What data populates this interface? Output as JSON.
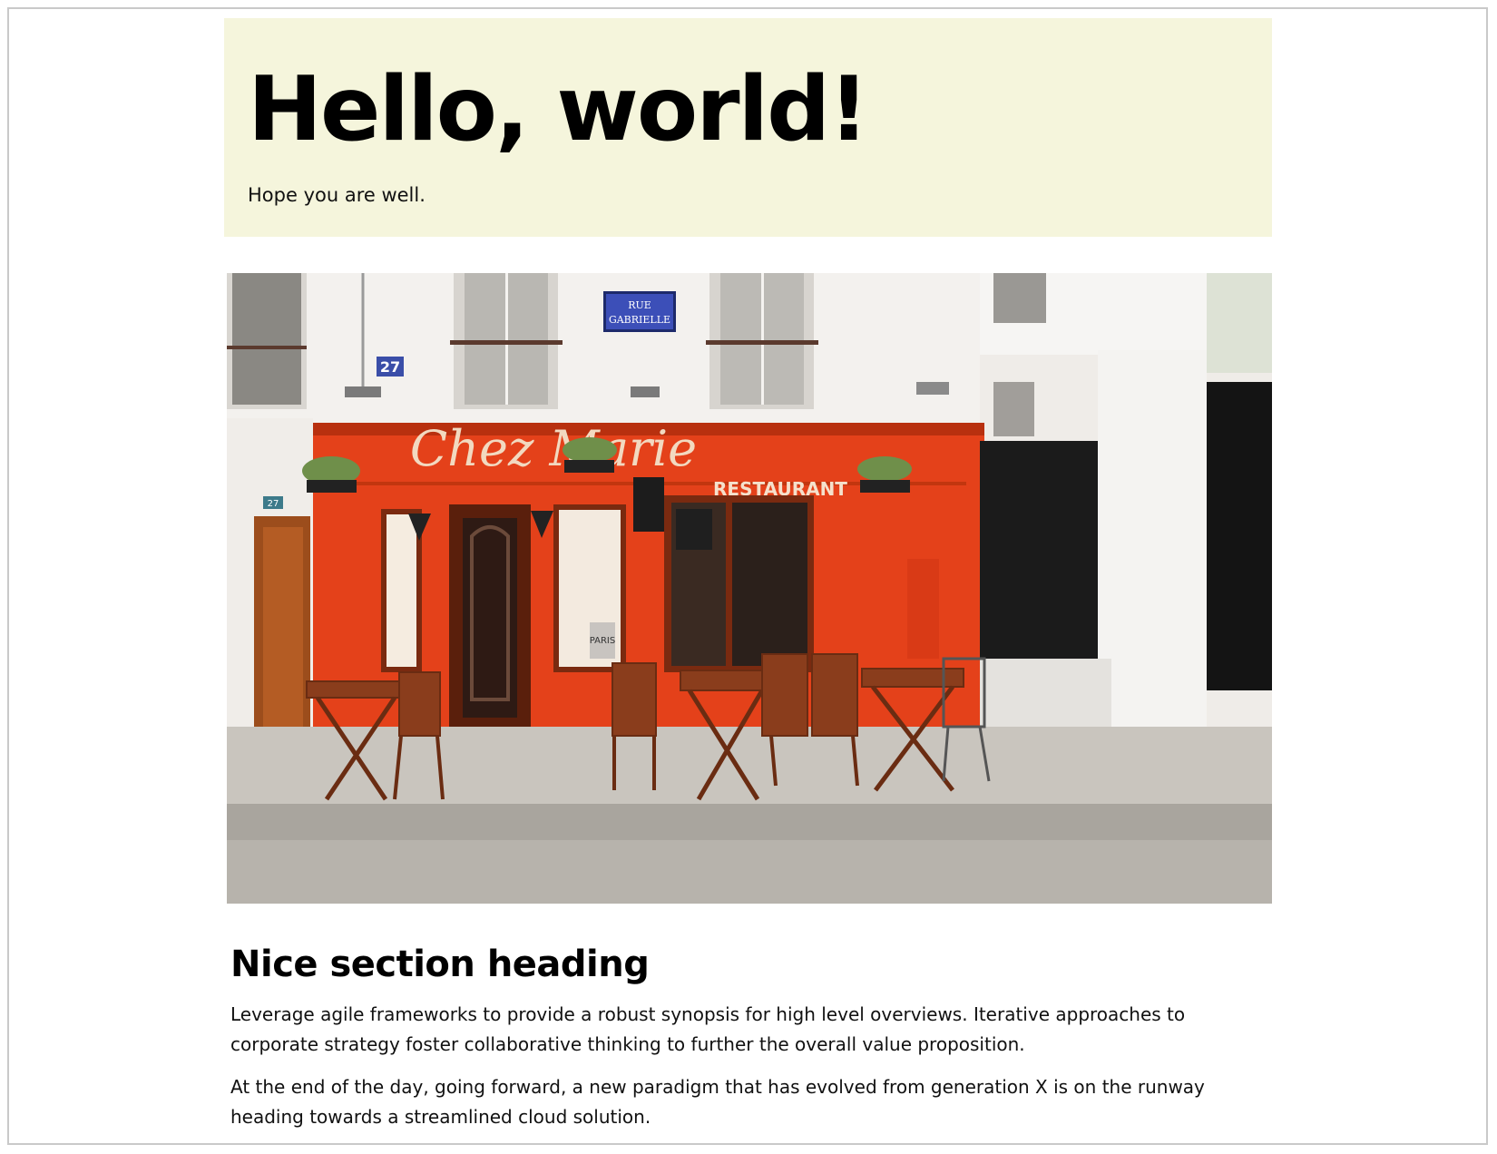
{
  "hero": {
    "title": "Hello, world!",
    "subtitle": "Hope you are well."
  },
  "photo": {
    "alt": "Red restaurant storefront with outdoor tables",
    "street_sign_line1": "RUE",
    "street_sign_line2": "GABRIELLE",
    "number_plate": "27",
    "number_plate_small": "27",
    "storefront_script": "Chez Marie",
    "storefront_word": "RESTAURANT",
    "poster_text": "PARIS",
    "colors": {
      "storefront": "#e4411a",
      "facade": "#f1eeea",
      "pavement": "#c9c5be",
      "hero_bg": "#f5f5dc"
    }
  },
  "section": {
    "heading": "Nice section heading",
    "paragraph1": "Leverage agile frameworks to provide a robust synopsis for high level overviews. Iterative approaches to corporate strategy foster collaborative thinking to further the overall value proposition.",
    "paragraph2": "At the end of the day, going forward, a new paradigm that has evolved from generation X is on the runway heading towards a streamlined cloud solution."
  }
}
